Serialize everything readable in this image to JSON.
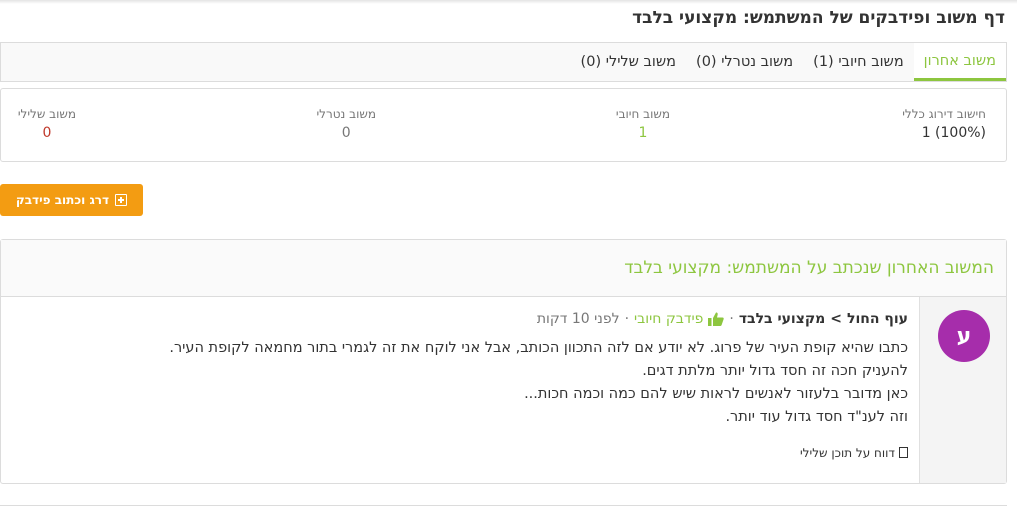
{
  "page": {
    "title": "דף משוב ופידבקים של המשתמש: מקצועי בלבד"
  },
  "tabs": [
    {
      "label": "משוב אחרון",
      "active": true
    },
    {
      "label": "משוב חיובי (1)",
      "active": false
    },
    {
      "label": "משוב נטרלי (0)",
      "active": false
    },
    {
      "label": "משוב שלילי (0)",
      "active": false
    }
  ],
  "stats": {
    "overall": {
      "label": "חישוב דירוג כללי",
      "value": "1 (100%)"
    },
    "positive": {
      "label": "משוב חיובי",
      "value": "1"
    },
    "neutral": {
      "label": "משוב נטרלי",
      "value": "0"
    },
    "negative": {
      "label": "משוב שלילי",
      "value": "0"
    }
  },
  "rate_button": {
    "label": "דרג וכתוב פידבק",
    "icon": "plus-square-icon"
  },
  "latest": {
    "heading": "המשוב האחרון שנכתב על המשתמש: מקצועי בלבד",
    "avatar_letter": "ע",
    "author": "עוף החול",
    "arrow": ">",
    "target": "מקצועי בלבד",
    "type_label": "פידבק חיובי",
    "sep": "·",
    "time": "לפני 10 דקות",
    "lines": [
      "כתבו שהיא קופת העיר של פרוג. לא יודע אם לזה התכוון הכותב, אבל אני לוקח את זה לגמרי בתור מחמאה לקופת העיר.",
      "להעניק חכה זה חסד גדול יותר מלתת דגים.",
      "כאן מדובר בלעזור לאנשים לראות שיש להם כמה וכמה חכות...",
      "וזה לענ\"ד חסד גדול עוד יותר."
    ],
    "report_label": "דווח על תוכן שלילי"
  },
  "colors": {
    "accent": "#8dc63f",
    "button": "#f39c12",
    "negative": "#c0392b",
    "avatar": "#a62dab"
  }
}
